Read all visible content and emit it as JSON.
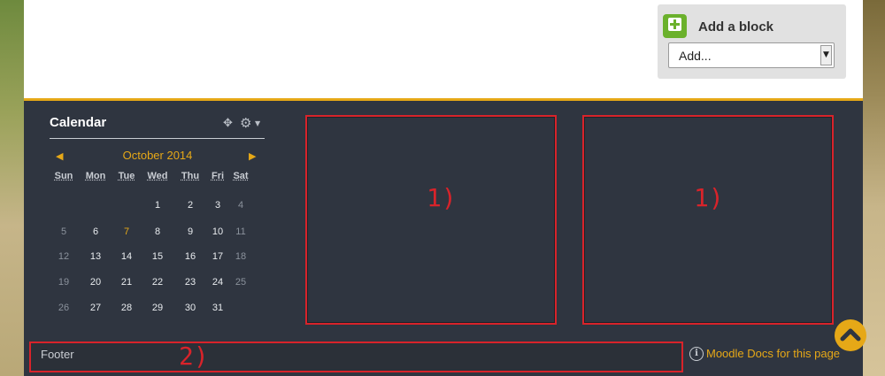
{
  "add_block": {
    "title": "Add a block",
    "select_value": "Add...",
    "icon": "plus-square-icon",
    "accent": "#6bb12c"
  },
  "calendar": {
    "title": "Calendar",
    "month_label": "October 2014",
    "prev_glyph": "◀",
    "next_glyph": "▶",
    "weekdays": [
      "Sun",
      "Mon",
      "Tue",
      "Wed",
      "Thu",
      "Fri",
      "Sat"
    ],
    "weeks": [
      [
        "",
        "",
        "",
        "1",
        "2",
        "3",
        "4"
      ],
      [
        "5",
        "6",
        "7",
        "8",
        "9",
        "10",
        "11"
      ],
      [
        "12",
        "13",
        "14",
        "15",
        "16",
        "17",
        "18"
      ],
      [
        "19",
        "20",
        "21",
        "22",
        "23",
        "24",
        "25"
      ],
      [
        "26",
        "27",
        "28",
        "29",
        "30",
        "31",
        ""
      ]
    ],
    "today": "7",
    "accent": "#e6a817"
  },
  "annotations": {
    "region_1a": "1)",
    "region_1b": "1)",
    "region_2": "2)",
    "color": "#d8232a"
  },
  "footer": {
    "text": "Footer",
    "docs_link": "Moodle Docs for this page"
  },
  "theme": {
    "panel": "#2f3540",
    "accent": "#e6a817"
  }
}
